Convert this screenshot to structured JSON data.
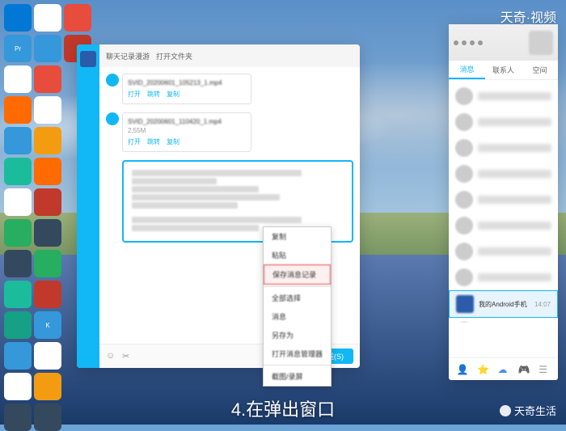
{
  "brand": {
    "top": "天奇·视频",
    "bottom": "天奇生活"
  },
  "subtitle": "4.在弹出窗口",
  "chat": {
    "tabs": [
      "聊天记录漫游",
      "打开文件夹"
    ],
    "files": [
      {
        "name": "SVID_20200601_105213_1.mp4",
        "size": "",
        "actions": [
          "打开",
          "跳转",
          "复制"
        ]
      },
      {
        "name": "SVID_20200601_110420_1.mp4",
        "size": "2.55M",
        "actions": [
          "打开",
          "跳转",
          "复制"
        ]
      }
    ],
    "send": "发送(S)"
  },
  "context_menu": {
    "items": [
      "复制",
      "粘贴",
      "保存消息记录",
      "全部选择",
      "消息",
      "另存为",
      "打开消息管理器",
      "截图/录屏"
    ],
    "highlighted_index": 2
  },
  "contacts": {
    "tabs": [
      "消息",
      "联系人",
      "空间"
    ],
    "device": {
      "name": "我的Android手机",
      "time": "14:07"
    },
    "footer_icons": [
      "person",
      "star",
      "cloud",
      "game",
      "menu"
    ]
  }
}
